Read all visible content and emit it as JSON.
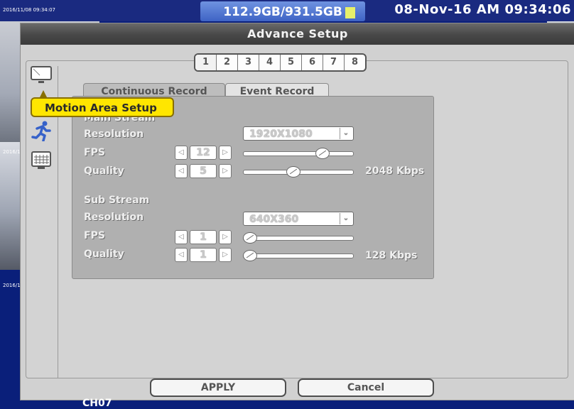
{
  "status": {
    "disk_usage": "112.9GB/931.5GB",
    "datetime": "08-Nov-16 AM 09:34:06",
    "cam_timestamp_top": "2016/11/08 09:34:07",
    "cam_timestamp_left_1": "2016/1",
    "cam_timestamp_left_2": "2016/1",
    "channel_label": "CH07"
  },
  "window": {
    "title": "Advance Setup"
  },
  "channel_tabs": [
    "1",
    "2",
    "3",
    "4",
    "5",
    "6",
    "7",
    "8"
  ],
  "sidebar": {
    "tooltip": "Motion Area Setup",
    "icons": [
      "monitor-icon",
      "motion-runner-icon",
      "grid-icon"
    ]
  },
  "record_tabs": {
    "continuous": "Continuous Record",
    "event": "Event Record"
  },
  "main_stream": {
    "heading": "Main Stream",
    "resolution_label": "Resolution",
    "resolution_value": "1920X1080",
    "fps_label": "FPS",
    "fps_value": "12",
    "fps_level": 0.75,
    "quality_label": "Quality",
    "quality_value": "5",
    "quality_level": 0.45,
    "bitrate": "2048 Kbps"
  },
  "sub_stream": {
    "heading": "Sub Stream",
    "resolution_label": "Resolution",
    "resolution_value": "640X360",
    "fps_label": "FPS",
    "fps_value": "1",
    "fps_level": 0.0,
    "quality_label": "Quality",
    "quality_value": "1",
    "quality_level": 0.0,
    "bitrate": "128 Kbps"
  },
  "buttons": {
    "apply": "APPLY",
    "cancel": "Cancel"
  },
  "colors": {
    "tooltip": "#ffe600",
    "title_bar": "#4a4a4a",
    "panel": "#b0b0b0",
    "background": "#0a1f7a"
  }
}
